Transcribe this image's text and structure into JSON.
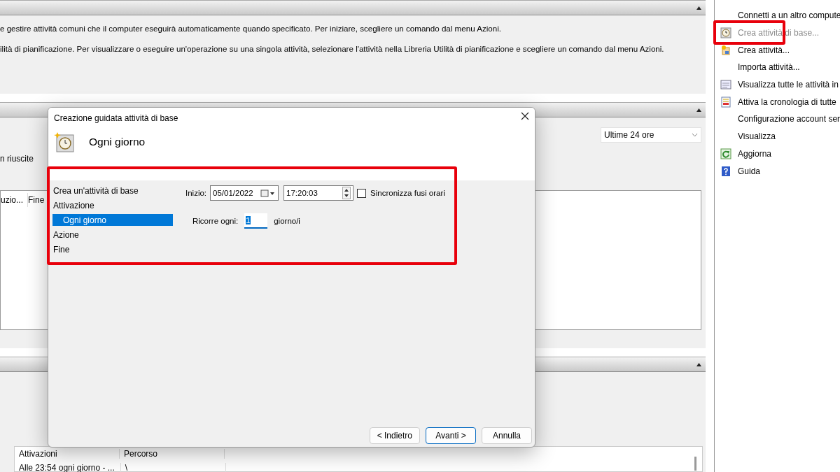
{
  "panels": [
    {
      "kind": "info",
      "lines": [
        "e gestire attività comuni che il computer eseguirà automaticamente quando specificato. Per iniziare, scegliere un comando dal menu Azioni.",
        "ilità di pianificazione. Per visualizzare o eseguire un'operazione su una singola attività, selezionare l'attività nella Libreria Utilità di pianificazione e scegliere un comando dal menu Azioni."
      ]
    },
    {
      "kind": "history",
      "range": "Ultime 24 ore",
      "summary": "n riuscite",
      "columns": [
        "uzio...",
        "Fine"
      ]
    },
    {
      "kind": "tasks",
      "columns": [
        "Attivazioni",
        "Percorso"
      ],
      "rows": [
        [
          "Alle 23:54 ogni giorno - ...",
          "\\"
        ]
      ]
    }
  ],
  "actions": [
    {
      "label": "Connetti a un altro compute",
      "disabled": false
    },
    {
      "label": "Crea attività di base...",
      "disabled": true
    },
    {
      "label": "Crea attività...",
      "disabled": false
    },
    {
      "label": "Importa attività...",
      "disabled": false
    },
    {
      "label": "Visualizza tutte le attività in",
      "disabled": false
    },
    {
      "label": "Attiva la cronologia di tutte",
      "disabled": false
    },
    {
      "label": "Configurazione account ser",
      "disabled": false
    },
    {
      "label": "Visualizza",
      "disabled": false
    },
    {
      "label": "Aggiorna",
      "disabled": false
    },
    {
      "label": "Guida",
      "disabled": false
    }
  ],
  "dialog": {
    "title": "Creazione guidata attività di base",
    "heading": "Ogni giorno",
    "steps": [
      {
        "label": "Crea un'attività di base",
        "selected": false
      },
      {
        "label": "Attivazione",
        "selected": false,
        "children": [
          {
            "label": "Ogni giorno",
            "selected": true
          }
        ]
      },
      {
        "label": "Azione",
        "selected": false
      },
      {
        "label": "Fine",
        "selected": false
      }
    ],
    "start_label": "Inizio:",
    "date": "05/01/2022",
    "time": "17:20:03",
    "sync": {
      "label": "Sincronizza fusi orari",
      "checked": false
    },
    "recur_label": "Ricorre ogni:",
    "recur_value": "1",
    "recur_unit": "giorno/i",
    "buttons": [
      {
        "label": "< Indietro",
        "default": false
      },
      {
        "label": "Avanti >",
        "default": true
      },
      {
        "label": "Annulla",
        "default": false
      }
    ]
  }
}
